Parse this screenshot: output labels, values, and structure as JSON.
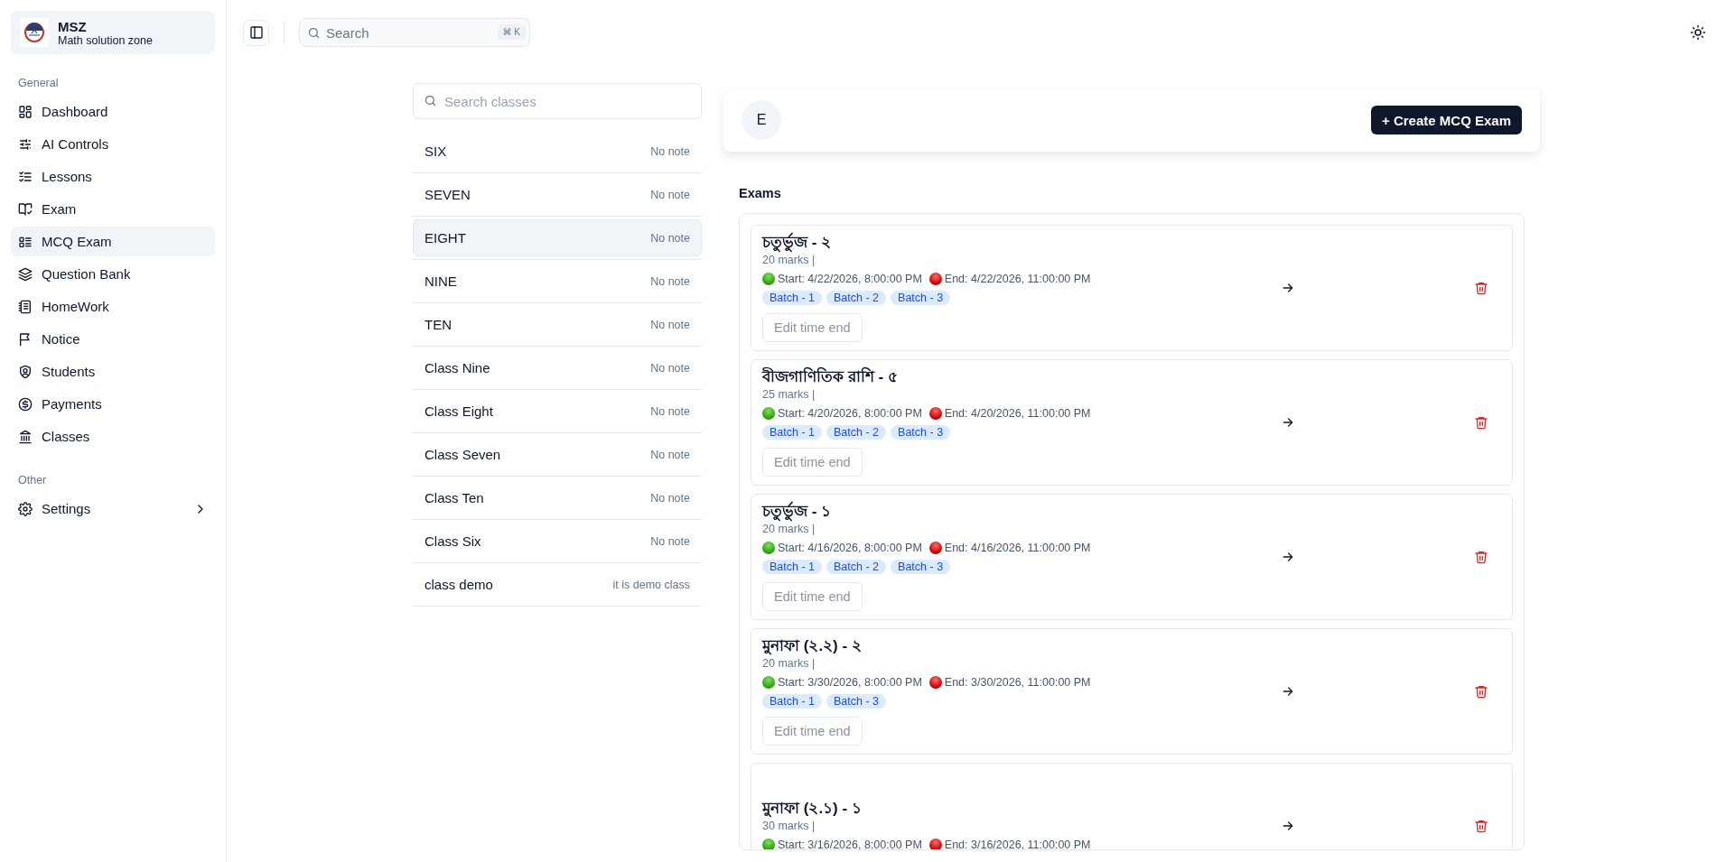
{
  "brand": {
    "name": "MSZ",
    "subtitle": "Math solution zone"
  },
  "sidebar": {
    "groups": [
      {
        "title": "General",
        "items": [
          {
            "label": "Dashboard",
            "selected": false
          },
          {
            "label": "AI Controls",
            "selected": false
          },
          {
            "label": "Lessons",
            "selected": false
          },
          {
            "label": "Exam",
            "selected": false
          },
          {
            "label": "MCQ Exam",
            "selected": true
          },
          {
            "label": "Question Bank",
            "selected": false
          },
          {
            "label": "HomeWork",
            "selected": false
          },
          {
            "label": "Notice",
            "selected": false
          },
          {
            "label": "Students",
            "selected": false
          },
          {
            "label": "Payments",
            "selected": false
          },
          {
            "label": "Classes",
            "selected": false
          }
        ]
      },
      {
        "title": "Other",
        "items": [
          {
            "label": "Settings",
            "selected": false,
            "expandable": true
          }
        ]
      }
    ]
  },
  "topbar": {
    "search": {
      "placeholder": "Search",
      "shortcut": "⌘ K"
    }
  },
  "classes": {
    "search": {
      "placeholder": "Search classes"
    },
    "items": [
      {
        "name": "SIX",
        "note": "No note",
        "selected": false
      },
      {
        "name": "SEVEN",
        "note": "No note",
        "selected": false
      },
      {
        "name": "EIGHT",
        "note": "No note",
        "selected": true
      },
      {
        "name": "NINE",
        "note": "No note",
        "selected": false
      },
      {
        "name": "TEN",
        "note": "No note",
        "selected": false
      },
      {
        "name": "Class Nine",
        "note": "No note",
        "selected": false
      },
      {
        "name": "Class Eight",
        "note": "No note",
        "selected": false
      },
      {
        "name": "Class Seven",
        "note": "No note",
        "selected": false
      },
      {
        "name": "Class Ten",
        "note": "No note",
        "selected": false
      },
      {
        "name": "Class Six",
        "note": "No note",
        "selected": false
      },
      {
        "name": "class demo",
        "note": "it is demo class",
        "selected": false
      }
    ]
  },
  "header": {
    "avatar": "E",
    "create_button": "+ Create MCQ Exam"
  },
  "exams": {
    "title": "Exams",
    "items": [
      {
        "title": "চতুর্ভুজ - ২",
        "marks": "20 marks |",
        "start": "Start: 4/22/2026, 8:00:00 PM",
        "end": "End: 4/22/2026, 11:00:00 PM",
        "batches": [
          "Batch - 1",
          "Batch - 2",
          "Batch - 3"
        ],
        "edit_button": "Edit time end"
      },
      {
        "title": "বীজগাণিতিক রাশি - ৫",
        "marks": "25 marks |",
        "start": "Start: 4/20/2026, 8:00:00 PM",
        "end": "End: 4/20/2026, 11:00:00 PM",
        "batches": [
          "Batch - 1",
          "Batch - 2",
          "Batch - 3"
        ],
        "edit_button": "Edit time end"
      },
      {
        "title": "চতুর্ভুজ - ১",
        "marks": "20 marks |",
        "start": "Start: 4/16/2026, 8:00:00 PM",
        "end": "End: 4/16/2026, 11:00:00 PM",
        "batches": [
          "Batch - 1",
          "Batch - 2",
          "Batch - 3"
        ],
        "edit_button": "Edit time end"
      },
      {
        "title": "মুনাফা (২.২) - ২",
        "marks": "20 marks |",
        "start": "Start: 3/30/2026, 8:00:00 PM",
        "end": "End: 3/30/2026, 11:00:00 PM",
        "batches": [
          "Batch - 1",
          "Batch - 3"
        ],
        "edit_button": "Edit time end"
      },
      {
        "title": "মুনাফা (২.১) - ১",
        "marks": "30 marks |",
        "start": "Start: 3/16/2026, 8:00:00 PM",
        "end": "End: 3/16/2026, 11:00:00 PM"
      }
    ]
  }
}
